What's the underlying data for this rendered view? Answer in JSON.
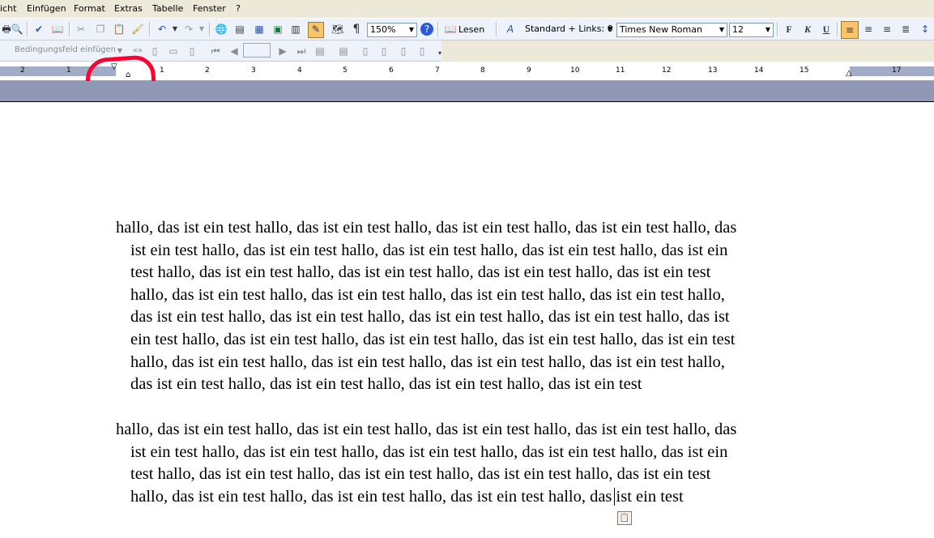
{
  "menubar": {
    "items": [
      "icht",
      "Einfügen",
      "Format",
      "Extras",
      "Tabelle",
      "Fenster",
      "?"
    ]
  },
  "toolbar": {
    "zoom": "150%",
    "read_label": "Lesen",
    "style": "Standard + Links:  0",
    "font": "Times New Roman",
    "size": "12",
    "bold": "F",
    "italic": "K",
    "underline": "U",
    "pilcrow": "¶"
  },
  "toolbar2": {
    "field_label": "Bedingungsfeld einfügen"
  },
  "ruler": {
    "numbers": [
      "2",
      "1",
      "1",
      "2",
      "3",
      "4",
      "5",
      "6",
      "7",
      "8",
      "9",
      "10",
      "11",
      "12",
      "13",
      "14",
      "15",
      "17"
    ]
  },
  "document": {
    "para1": [
      "hallo, das ist ein test hallo, das ist ein test hallo, das ist ein test hallo, das ist ein test hallo, das",
      "ist ein test hallo, das ist ein test hallo, das ist ein test hallo, das ist ein test hallo, das ist ein",
      "test hallo, das ist ein test hallo, das ist ein test hallo, das ist ein test hallo, das ist ein test",
      "hallo, das ist ein test hallo, das ist ein test hallo, das ist ein test hallo, das ist ein test hallo,",
      "das ist ein test hallo, das ist ein test hallo, das ist ein test hallo, das ist ein test hallo, das ist",
      "ein test hallo, das ist ein test hallo, das ist ein test hallo, das ist ein test hallo, das ist ein test",
      "hallo, das ist ein test hallo, das ist ein test hallo, das ist ein test hallo, das ist ein test hallo,",
      "das ist ein test hallo, das ist ein test hallo, das ist ein test hallo, das ist ein test"
    ],
    "para2": [
      "hallo, das ist ein test hallo, das ist ein test hallo, das ist ein test hallo, das ist ein test hallo, das",
      "ist ein test hallo, das ist ein test hallo, das ist ein test hallo, das ist ein test hallo, das ist ein",
      "test hallo, das ist ein test hallo, das ist ein test hallo, das ist ein test hallo, das ist ein test",
      "hallo, das ist ein test hallo, das ist ein test hallo, das ist ein test hallo, das ist ein test"
    ]
  },
  "colors": {
    "annotation": "#ff0033",
    "toolbar_bg": "#eef2fb",
    "workspace": "#8f98b4"
  }
}
